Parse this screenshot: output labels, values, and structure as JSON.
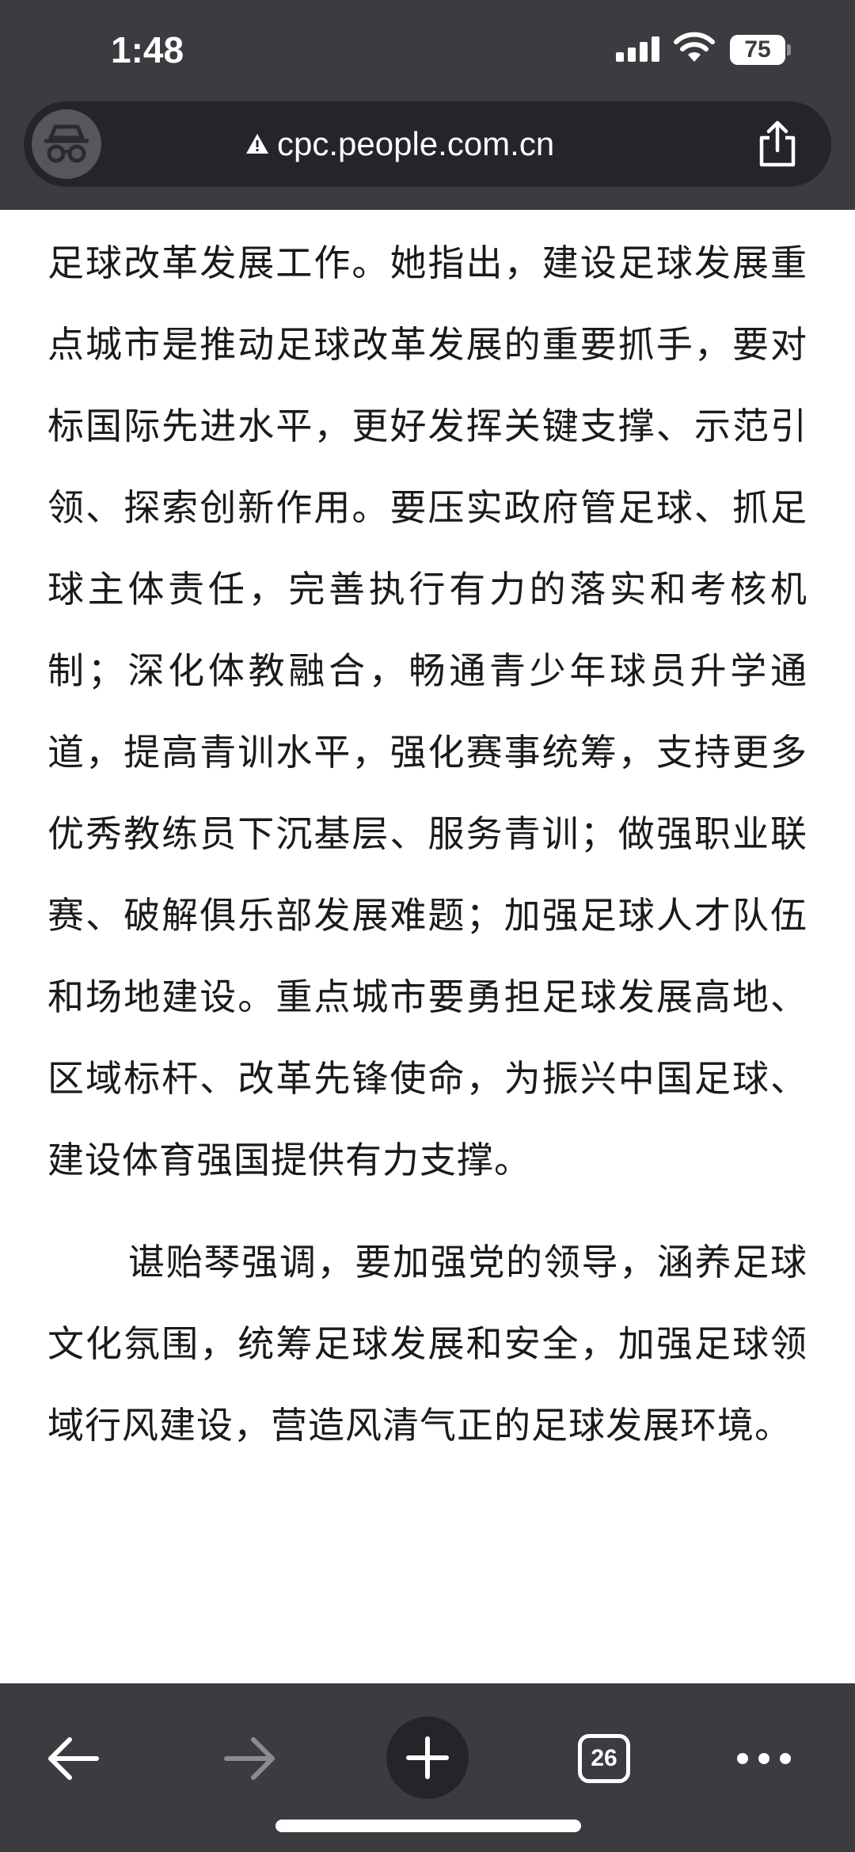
{
  "status_bar": {
    "time": "1:48",
    "battery": "75"
  },
  "browser": {
    "url": "cpc.people.com.cn",
    "open_tabs": "26",
    "icons": {
      "incognito": "incognito-icon",
      "security": "warning-icon",
      "share": "share-icon",
      "back": "arrow-left-icon",
      "forward": "arrow-right-icon",
      "new_tab": "plus-icon",
      "tabs": "tabs-icon",
      "more": "more-icon"
    }
  },
  "article": {
    "paragraphs": [
      "足球改革发展工作。她指出，建设足球发展重点城市是推动足球改革发展的重要抓手，要对标国际先进水平，更好发挥关键支撑、示范引领、探索创新作用。要压实政府管足球、抓足球主体责任，完善执行有力的落实和考核机制；深化体教融合，畅通青少年球员升学通道，提高青训水平，强化赛事统筹，支持更多优秀教练员下沉基层、服务青训；做强职业联赛、破解俱乐部发展难题；加强足球人才队伍和场地建设。重点城市要勇担足球发展高地、区域标杆、改革先锋使命，为振兴中国足球、建设体育强国提供有力支撑。",
      "谌贻琴强调，要加强党的领导，涵养足球文化氛围，统筹足球发展和安全，加强足球领域行风建设，营造风清气正的足球发展环境。"
    ]
  },
  "colors": {
    "chrome_bg": "#3a3c3f",
    "url_bar_bg": "#242528",
    "text": "#1a1a1a",
    "disabled": "#8a8c8f"
  }
}
